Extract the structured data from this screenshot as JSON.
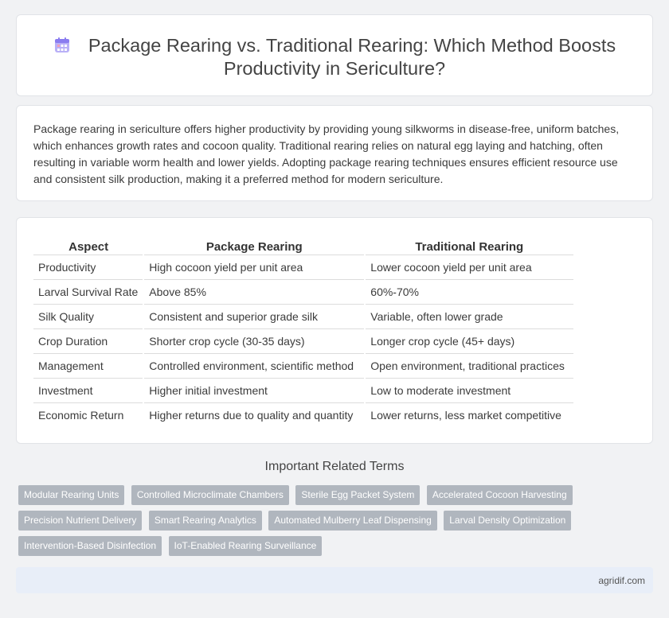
{
  "header": {
    "title": "Package Rearing vs. Traditional Rearing: Which Method Boosts Productivity in Sericulture?",
    "icon": "calendar-icon",
    "icon_color": "#8a7cf0"
  },
  "intro": {
    "text": "Package rearing in sericulture offers higher productivity by providing young silkworms in disease-free, uniform batches, which enhances growth rates and cocoon quality. Traditional rearing relies on natural egg laying and hatching, often resulting in variable worm health and lower yields. Adopting package rearing techniques ensures efficient resource use and consistent silk production, making it a preferred method for modern sericulture."
  },
  "table": {
    "headers": [
      "Aspect",
      "Package Rearing",
      "Traditional Rearing"
    ],
    "rows": [
      [
        "Productivity",
        "High cocoon yield per unit area",
        "Lower cocoon yield per unit area"
      ],
      [
        "Larval Survival Rate",
        "Above 85%",
        "60%-70%"
      ],
      [
        "Silk Quality",
        "Consistent and superior grade silk",
        "Variable, often lower grade"
      ],
      [
        "Crop Duration",
        "Shorter crop cycle (30-35 days)",
        "Longer crop cycle (45+ days)"
      ],
      [
        "Management",
        "Controlled environment, scientific method",
        "Open environment, traditional practices"
      ],
      [
        "Investment",
        "Higher initial investment",
        "Low to moderate investment"
      ],
      [
        "Economic Return",
        "Higher returns due to quality and quantity",
        "Lower returns, less market competitive"
      ]
    ]
  },
  "related": {
    "title": "Important Related Terms",
    "tags": [
      "Modular Rearing Units",
      "Controlled Microclimate Chambers",
      "Sterile Egg Packet System",
      "Accelerated Cocoon Harvesting",
      "Precision Nutrient Delivery",
      "Smart Rearing Analytics",
      "Automated Mulberry Leaf Dispensing",
      "Larval Density Optimization",
      "Intervention-Based Disinfection",
      "IoT-Enabled Rearing Surveillance"
    ]
  },
  "footer": {
    "site": "agridif.com"
  }
}
